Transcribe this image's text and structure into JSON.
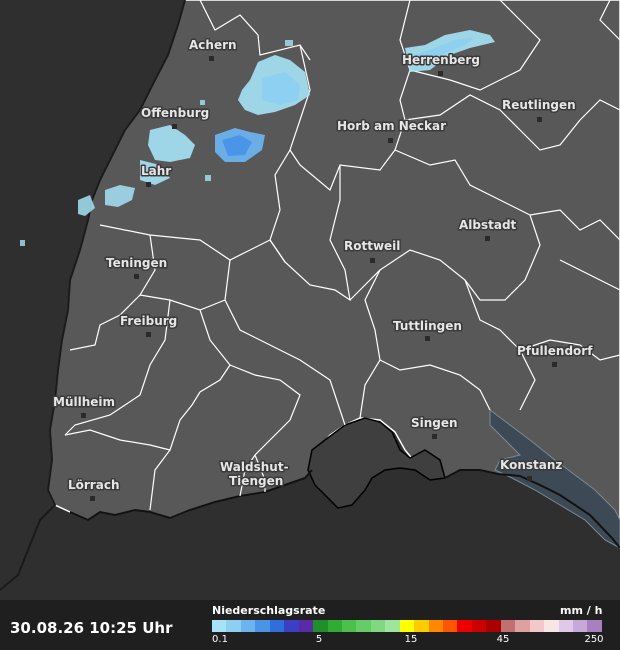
{
  "cities": [
    {
      "id": "achern",
      "name": "Achern"
    },
    {
      "id": "herrenberg",
      "name": "Herrenberg"
    },
    {
      "id": "offenburg",
      "name": "Offenburg"
    },
    {
      "id": "reutlingen",
      "name": "Reutlingen"
    },
    {
      "id": "horb",
      "name": "Horb am Neckar"
    },
    {
      "id": "lahr",
      "name": "Lahr"
    },
    {
      "id": "albstadt",
      "name": "Albstadt"
    },
    {
      "id": "rottweil",
      "name": "Rottweil"
    },
    {
      "id": "teningen",
      "name": "Teningen"
    },
    {
      "id": "freiburg",
      "name": "Freiburg"
    },
    {
      "id": "tuttlingen",
      "name": "Tuttlingen"
    },
    {
      "id": "pfullendorf",
      "name": "Pfullendorf"
    },
    {
      "id": "muellheim",
      "name": "Müllheim"
    },
    {
      "id": "singen",
      "name": "Singen"
    },
    {
      "id": "waldshut",
      "name": "Waldshut-\nTiengen"
    },
    {
      "id": "loerrach",
      "name": "Lörrach"
    },
    {
      "id": "konstanz",
      "name": "Konstanz"
    }
  ],
  "footer": {
    "timestamp": "30.08.26 10:25 Uhr"
  },
  "legend": {
    "title": "Niederschlagsrate",
    "unit": "mm / h",
    "colors": [
      "#a6e3f7",
      "#8ccff3",
      "#6db3ee",
      "#4a94e8",
      "#2e6fdd",
      "#3a3fc6",
      "#5b2aa8",
      "#1f8f2a",
      "#33aa33",
      "#4cbf4c",
      "#66cc66",
      "#80d980",
      "#9ee69e",
      "#ffff00",
      "#ffcc00",
      "#ff8800",
      "#ff5500",
      "#ee0000",
      "#cc0000",
      "#aa0000",
      "#c07070",
      "#e0a0a0",
      "#f2c8c8",
      "#f8e6e6",
      "#e0c8e8",
      "#c8a8d8",
      "#a880c0"
    ],
    "ticks": [
      "0.1",
      "5",
      "15",
      "45",
      "250"
    ]
  }
}
